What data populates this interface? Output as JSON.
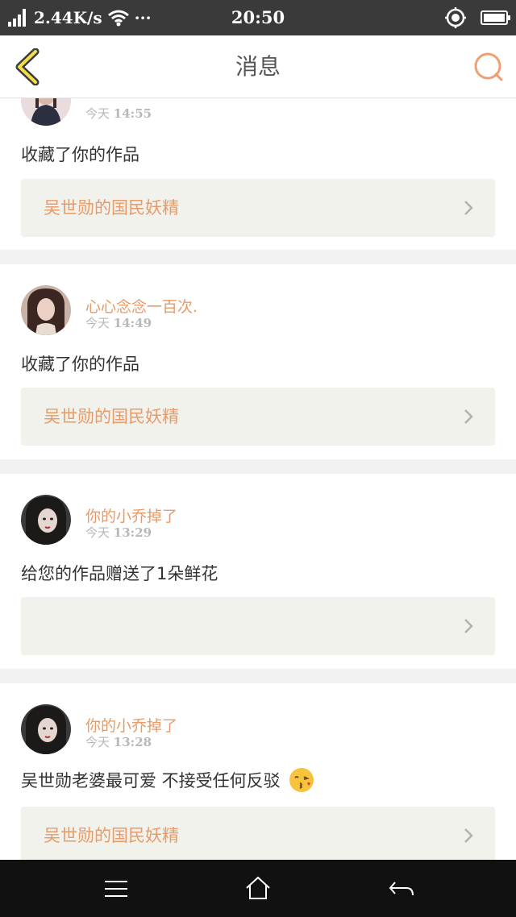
{
  "status_bar": {
    "network_speed": "2.44K/s",
    "more": "···",
    "time": "20:50",
    "icons": [
      "signal-icon",
      "wifi-icon",
      "location-icon",
      "battery-icon"
    ]
  },
  "header": {
    "title": "消息",
    "back_icon": "chevron-left-icon",
    "search_icon": "search-icon",
    "accent_color": "#e89a68"
  },
  "messages": [
    {
      "sender": "",
      "time_prefix": "今天",
      "time": "14:55",
      "text": "收藏了你的作品",
      "work_title": "吴世勋的国民妖精"
    },
    {
      "sender": "心心念念一百次.",
      "time_prefix": "今天",
      "time": "14:49",
      "text": "收藏了你的作品",
      "work_title": "吴世勋的国民妖精"
    },
    {
      "sender": "你的小乔掉了",
      "time_prefix": "今天",
      "time": "13:29",
      "text": "给您的作品赠送了1朵鲜花",
      "work_title": ""
    },
    {
      "sender": "你的小乔掉了",
      "time_prefix": "今天",
      "time": "13:28",
      "text": "吴世勋老婆最可爱 不接受任何反驳",
      "emoji": "kissing-face-emoji",
      "work_title": "吴世勋的国民妖精"
    }
  ],
  "nav_bar": {
    "icons": [
      "menu-icon",
      "home-icon",
      "back-arrow-icon"
    ]
  }
}
